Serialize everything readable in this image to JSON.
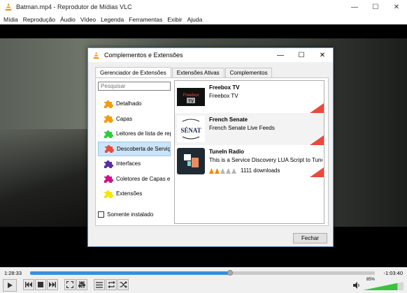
{
  "window": {
    "title": "Batman.mp4 - Reprodutor de Mídias VLC"
  },
  "menu": [
    "Mídia",
    "Reprodução",
    "Áudio",
    "Vídeo",
    "Legenda",
    "Ferramentas",
    "Exibir",
    "Ajuda"
  ],
  "dialog": {
    "title": "Complementos e Extensões",
    "tabs": [
      "Gerenciador de Extensões",
      "Extensões Ativas",
      "Complementos"
    ],
    "search_placeholder": "Pesquisar",
    "categories": [
      {
        "label": "Detalhado",
        "color": "#f39c12"
      },
      {
        "label": "Capas",
        "color": "#f39c12"
      },
      {
        "label": "Leitores de lista de reprodução",
        "color": "#2ecc40"
      },
      {
        "label": "Descoberta de Serviços",
        "color": "#e74c3c"
      },
      {
        "label": "Interfaces",
        "color": "#5b2fa3"
      },
      {
        "label": "Coletores de Capas e Metadados",
        "color": "#c71585"
      },
      {
        "label": "Extensões",
        "color": "#f5e60a"
      }
    ],
    "selected_category": 3,
    "only_installed_label": "Somente instalado",
    "extensions": [
      {
        "name": "Freebox TV",
        "description": "Freebox TV",
        "thumb_text": "Freebox TV"
      },
      {
        "name": "French Senate",
        "description": "French Senate Live Feeds",
        "thumb_text": "SÉNAT"
      },
      {
        "name": "TuneIn Radio",
        "description": "This is a Service Discovery LUA Script to TuneIn Radio",
        "rating": 2,
        "rating_max": 5,
        "downloads": "1111 downloads"
      }
    ],
    "close_label": "Fechar"
  },
  "player": {
    "time_elapsed": "1:28:33",
    "time_remaining": "-1:03:40",
    "progress": 0.58,
    "volume_label": "85%",
    "volume": 0.85
  }
}
